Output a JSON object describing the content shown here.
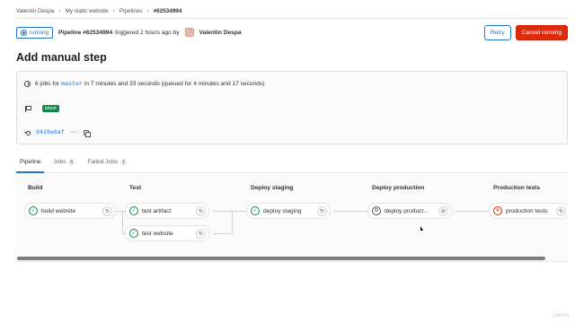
{
  "breadcrumb": {
    "items": [
      "Valentin Despa",
      "My static website",
      "Pipelines",
      "#62534994"
    ],
    "separator": "›"
  },
  "header": {
    "status": "running",
    "pipeline_label": "Pipeline #62534994",
    "triggered_text": "triggered 2 hours ago by",
    "user": "Valentin Despa",
    "retry_label": "Retry",
    "cancel_label": "Cancel running"
  },
  "title": "Add manual step",
  "info": {
    "jobs_prefix": "6 jobs for",
    "branch": "master",
    "duration_text": "in 7 minutes and 33 seconds (queued for 4 minutes and 17 seconds)",
    "latest_label": "latest",
    "commit_sha": "8419e6af",
    "ellipsis": "···"
  },
  "tabs": [
    {
      "label": "Pipeline",
      "count": null,
      "active": true
    },
    {
      "label": "Jobs",
      "count": "6",
      "active": false
    },
    {
      "label": "Failed Jobs",
      "count": "1",
      "active": false
    }
  ],
  "stages": [
    {
      "name": "Build",
      "jobs": [
        {
          "name": "build website",
          "status": "success",
          "action": "retry"
        }
      ]
    },
    {
      "name": "Test",
      "jobs": [
        {
          "name": "test artifact",
          "status": "success",
          "action": "retry"
        },
        {
          "name": "test website",
          "status": "success",
          "action": "retry"
        }
      ]
    },
    {
      "name": "Deploy staging",
      "jobs": [
        {
          "name": "deploy staging",
          "status": "success",
          "action": "retry"
        }
      ]
    },
    {
      "name": "Deploy production",
      "jobs": [
        {
          "name": "deploy product...",
          "status": "manual",
          "action": "cancel"
        }
      ]
    },
    {
      "name": "Production tests",
      "jobs": [
        {
          "name": "production tests",
          "status": "failed",
          "action": "retry"
        }
      ]
    }
  ],
  "icons": {
    "success": "✓",
    "failed": "✕",
    "manual": "⚙",
    "retry": "↻",
    "cancel": "⊘"
  },
  "colors": {
    "accent": "#1f75cb",
    "success": "#108548",
    "danger": "#dd2b0e"
  },
  "watermark": "Udemy"
}
